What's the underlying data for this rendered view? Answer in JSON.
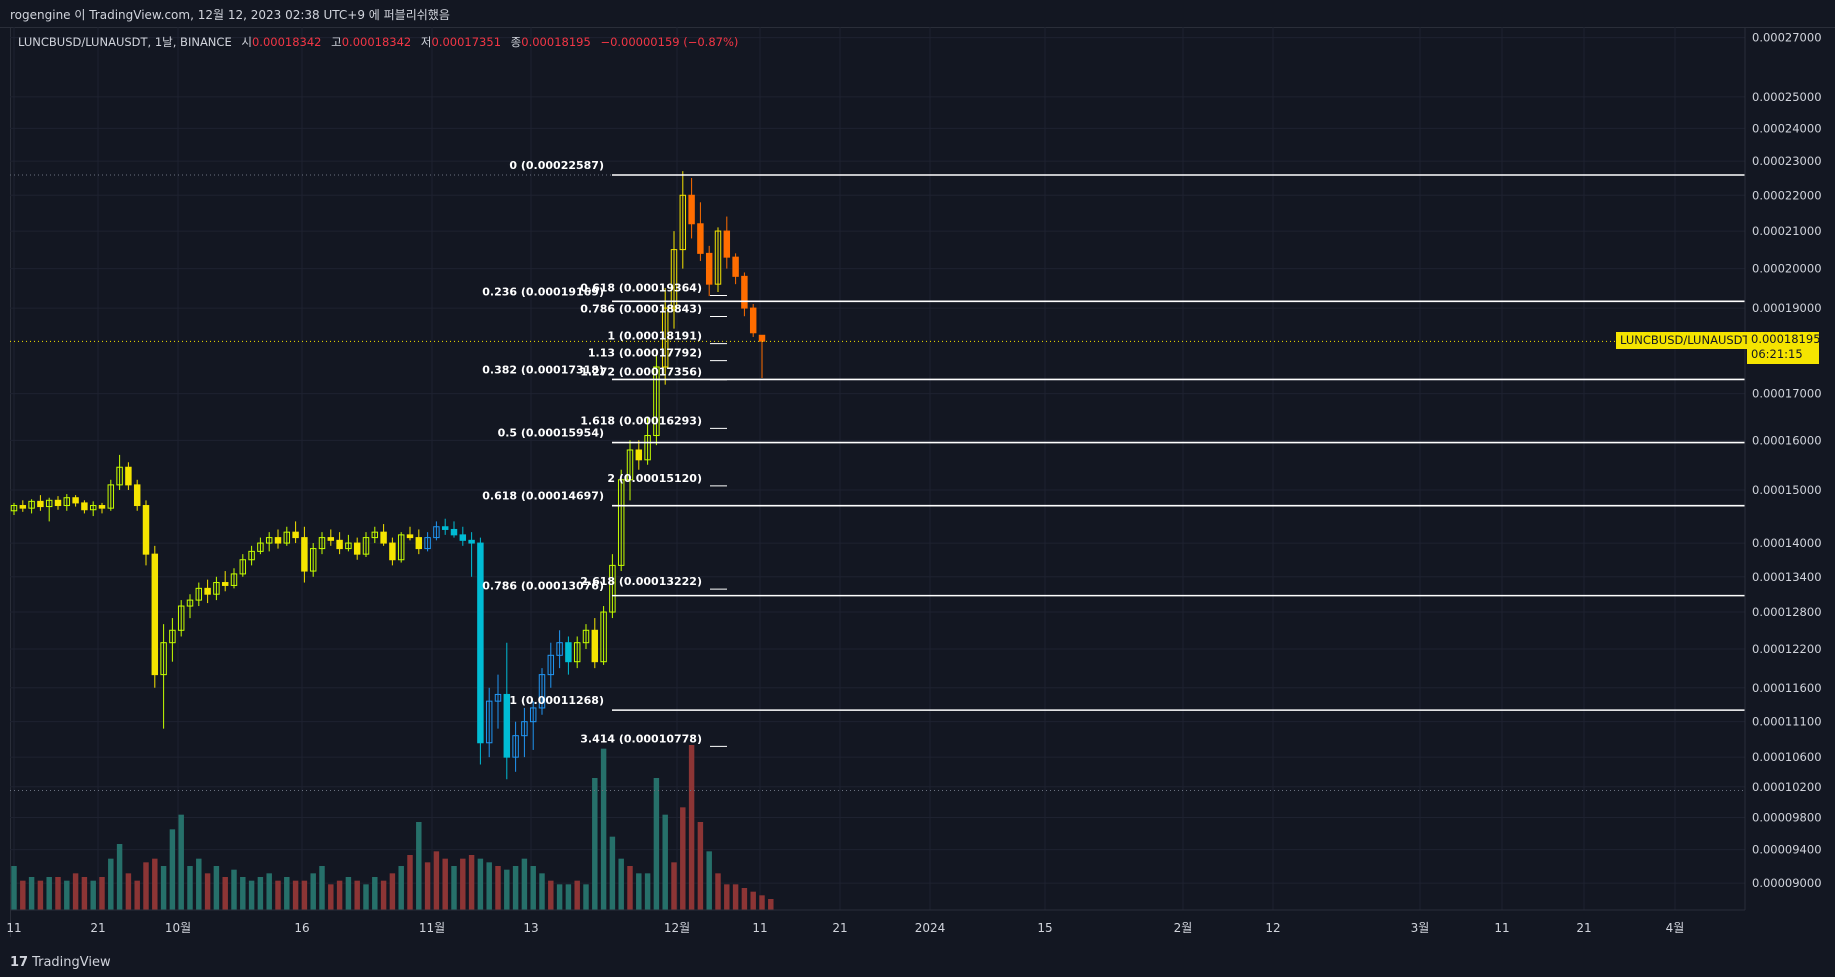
{
  "header": {
    "published": "rogengine 이 TradingView.com, 12월 12, 2023 02:38 UTC+9 에 퍼블리쉬했음"
  },
  "legend": {
    "symbol": "LUNCBUSD/LUNAUSDT, 1날, BINANCE",
    "open_label": "시",
    "open": "0.00018342",
    "high_label": "고",
    "high": "0.00018342",
    "low_label": "저",
    "low": "0.00017351",
    "close_label": "종",
    "close": "0.00018195",
    "change": "−0.00000159 (−0.87%)"
  },
  "price_tag": {
    "symbol": "LUNCBUSD/LUNAUSDT",
    "price": "0.00018195",
    "countdown": "06:21:15"
  },
  "footer": {
    "brand": "TradingView",
    "logo": "17"
  },
  "colors": {
    "background": "#131722",
    "grid": "#1f2330",
    "axis_text": "#d1d4dc",
    "price_tag": "#f5e400",
    "change": "#f23645"
  },
  "chart_data": {
    "type": "candlestick",
    "y_scale": "log",
    "ylim": [
      8.85e-05,
      0.000272
    ],
    "y_ticks": [
      "0.00027000",
      "0.00025000",
      "0.00024000",
      "0.00023000",
      "0.00022000",
      "0.00021000",
      "0.00020000",
      "0.00019000",
      "0.00017000",
      "0.00016000",
      "0.00015000",
      "0.00014000",
      "0.00013400",
      "0.00012800",
      "0.00012200",
      "0.00011600",
      "0.00011100",
      "0.00010600",
      "0.00010200",
      "0.00009800",
      "0.00009400",
      "0.00009000"
    ],
    "x_ticks": [
      "11",
      "21",
      "10월",
      "16",
      "11월",
      "13",
      "12월",
      "11",
      "21",
      "2024",
      "15",
      "2월",
      "12",
      "3월",
      "11",
      "21",
      "4월"
    ],
    "fib_retracement": [
      {
        "label": "0 (0.00022587)",
        "value": 0.00022587
      },
      {
        "label": "0.236 (0.00019169)",
        "value": 0.00019169
      },
      {
        "label": "0.382 (0.00017318)",
        "value": 0.00017318
      },
      {
        "label": "0.5 (0.00015954)",
        "value": 0.00015954
      },
      {
        "label": "0.618 (0.00014697)",
        "value": 0.00014697
      },
      {
        "label": "0.786 (0.00013076)",
        "value": 0.00013076
      },
      {
        "label": "1 (0.00011268)",
        "value": 0.00011268
      }
    ],
    "fib_extension": [
      {
        "label": "0.618 (0.00019364)",
        "value": 0.00019364
      },
      {
        "label": "0.786 (0.00018843)",
        "value": 0.00018843
      },
      {
        "label": "1 (0.00018191)",
        "value": 0.00018191
      },
      {
        "label": "1.13 (0.00017792)",
        "value": 0.00017792
      },
      {
        "label": "1.272 (0.00017356)",
        "value": 0.00017356
      },
      {
        "label": "1.618 (0.00016293)",
        "value": 0.00016293
      },
      {
        "label": "2 (0.00015120)",
        "value": 0.0001512
      },
      {
        "label": "2.618 (0.00013222)",
        "value": 0.00013222
      },
      {
        "label": "3.414 (0.00010778)",
        "value": 0.00010778
      }
    ],
    "candles": [
      [
        0.000146,
        0.0001475,
        0.0001452,
        0.000147
      ],
      [
        0.000147,
        0.000148,
        0.0001458,
        0.0001465
      ],
      [
        0.0001465,
        0.0001482,
        0.0001455,
        0.0001478
      ],
      [
        0.0001478,
        0.000149,
        0.000146,
        0.0001468
      ],
      [
        0.0001468,
        0.0001485,
        0.000144,
        0.000148
      ],
      [
        0.000148,
        0.0001488,
        0.0001462,
        0.000147
      ],
      [
        0.000147,
        0.0001492,
        0.000146,
        0.0001485
      ],
      [
        0.0001485,
        0.000149,
        0.0001468,
        0.0001475
      ],
      [
        0.0001475,
        0.000148,
        0.0001455,
        0.0001462
      ],
      [
        0.0001462,
        0.0001478,
        0.000145,
        0.000147
      ],
      [
        0.000147,
        0.0001475,
        0.0001455,
        0.0001465
      ],
      [
        0.0001465,
        0.000152,
        0.000146,
        0.000151
      ],
      [
        0.000151,
        0.000157,
        0.00015,
        0.0001545
      ],
      [
        0.0001545,
        0.0001555,
        0.00015,
        0.000151
      ],
      [
        0.000151,
        0.000152,
        0.000146,
        0.000147
      ],
      [
        0.000147,
        0.000148,
        0.000136,
        0.000138
      ],
      [
        0.000138,
        0.0001395,
        0.000116,
        0.000118
      ],
      [
        0.000118,
        0.000126,
        0.00011,
        0.000123
      ],
      [
        0.000123,
        0.000127,
        0.00012,
        0.000125
      ],
      [
        0.000125,
        0.00013,
        0.000124,
        0.000129
      ],
      [
        0.000129,
        0.000131,
        0.000127,
        0.00013
      ],
      [
        0.00013,
        0.000133,
        0.000129,
        0.000132
      ],
      [
        0.000132,
        0.0001335,
        0.0001295,
        0.000131
      ],
      [
        0.000131,
        0.000134,
        0.00013,
        0.000133
      ],
      [
        0.000133,
        0.000135,
        0.0001315,
        0.0001325
      ],
      [
        0.0001325,
        0.0001355,
        0.000132,
        0.0001345
      ],
      [
        0.0001345,
        0.000138,
        0.000134,
        0.000137
      ],
      [
        0.000137,
        0.0001395,
        0.000136,
        0.0001385
      ],
      [
        0.0001385,
        0.000141,
        0.000138,
        0.00014
      ],
      [
        0.00014,
        0.000142,
        0.0001385,
        0.000141
      ],
      [
        0.000141,
        0.0001425,
        0.000139,
        0.00014
      ],
      [
        0.00014,
        0.000143,
        0.0001395,
        0.000142
      ],
      [
        0.000142,
        0.000144,
        0.00014,
        0.000141
      ],
      [
        0.000141,
        0.000143,
        0.000133,
        0.000135
      ],
      [
        0.000135,
        0.00014,
        0.000134,
        0.000139
      ],
      [
        0.000139,
        0.000142,
        0.000138,
        0.000141
      ],
      [
        0.000141,
        0.0001425,
        0.0001395,
        0.0001405
      ],
      [
        0.0001405,
        0.000142,
        0.000138,
        0.000139
      ],
      [
        0.000139,
        0.0001415,
        0.0001385,
        0.00014
      ],
      [
        0.00014,
        0.000141,
        0.000137,
        0.000138
      ],
      [
        0.000138,
        0.000142,
        0.0001375,
        0.000141
      ],
      [
        0.000141,
        0.000143,
        0.00014,
        0.000142
      ],
      [
        0.000142,
        0.0001435,
        0.0001395,
        0.00014
      ],
      [
        0.00014,
        0.000141,
        0.000136,
        0.000137
      ],
      [
        0.000137,
        0.000142,
        0.0001365,
        0.0001415
      ],
      [
        0.0001415,
        0.000143,
        0.0001405,
        0.000141
      ],
      [
        0.000141,
        0.0001425,
        0.000138,
        0.000139
      ],
      [
        0.000139,
        0.000142,
        0.0001385,
        0.000141
      ],
      [
        0.000141,
        0.000144,
        0.0001405,
        0.000143
      ],
      [
        0.000143,
        0.0001445,
        0.0001415,
        0.0001425
      ],
      [
        0.0001425,
        0.000144,
        0.000141,
        0.0001415
      ],
      [
        0.0001415,
        0.000143,
        0.0001395,
        0.0001405
      ],
      [
        0.0001405,
        0.000142,
        0.000134,
        0.00014
      ],
      [
        0.00014,
        0.000141,
        0.000105,
        0.000108
      ],
      [
        0.000108,
        0.000116,
        0.000106,
        0.000114
      ],
      [
        0.000114,
        0.000118,
        0.00011,
        0.000115
      ],
      [
        0.000115,
        0.000123,
        0.000103,
        0.000106
      ],
      [
        0.000106,
        0.000111,
        0.000104,
        0.000109
      ],
      [
        0.000109,
        0.000113,
        0.000106,
        0.000111
      ],
      [
        0.000111,
        0.000114,
        0.000107,
        0.000113
      ],
      [
        0.000113,
        0.000119,
        0.000112,
        0.000118
      ],
      [
        0.000118,
        0.000123,
        0.000116,
        0.000121
      ],
      [
        0.000121,
        0.000125,
        0.000119,
        0.000123
      ],
      [
        0.000123,
        0.000124,
        0.000118,
        0.00012
      ],
      [
        0.00012,
        0.000124,
        0.000119,
        0.000123
      ],
      [
        0.000123,
        0.000126,
        0.000122,
        0.000125
      ],
      [
        0.000125,
        0.000127,
        0.000119,
        0.00012
      ],
      [
        0.00012,
        0.000129,
        0.0001195,
        0.000128
      ],
      [
        0.000128,
        0.000138,
        0.000127,
        0.000136
      ],
      [
        0.000136,
        0.000154,
        0.000135,
        0.000152
      ],
      [
        0.000152,
        0.00016,
        0.000148,
        0.000158
      ],
      [
        0.000158,
        0.00016,
        0.000154,
        0.000156
      ],
      [
        0.000156,
        0.000165,
        0.000155,
        0.000161
      ],
      [
        0.000161,
        0.00018,
        0.000159,
        0.000176
      ],
      [
        0.000176,
        0.000195,
        0.000172,
        0.00019
      ],
      [
        0.00019,
        0.00021,
        0.000185,
        0.000205
      ],
      [
        0.000205,
        0.000227,
        0.0002,
        0.00022
      ],
      [
        0.00022,
        0.000225,
        0.000208,
        0.000212
      ],
      [
        0.000212,
        0.000218,
        0.000202,
        0.000204
      ],
      [
        0.000204,
        0.000206,
        0.000193,
        0.000196
      ],
      [
        0.000196,
        0.000211,
        0.000194,
        0.00021
      ],
      [
        0.00021,
        0.000214,
        0.0002,
        0.000203
      ],
      [
        0.000203,
        0.000204,
        0.000196,
        0.000198
      ],
      [
        0.000198,
        0.000199,
        0.000188,
        0.00019
      ],
      [
        0.00019,
        0.000191,
        0.000183,
        0.000184
      ],
      [
        0.0001834,
        0.0001834,
        0.0001735,
        0.000182
      ]
    ],
    "volume": [
      12,
      8,
      9,
      8,
      9,
      9,
      8,
      10,
      9,
      8,
      9,
      14,
      18,
      10,
      8,
      13,
      14,
      12,
      22,
      26,
      12,
      14,
      10,
      12,
      9,
      11,
      9,
      8,
      9,
      10,
      8,
      9,
      8,
      8,
      10,
      12,
      7,
      8,
      9,
      8,
      7,
      9,
      8,
      10,
      12,
      15,
      24,
      13,
      16,
      14,
      12,
      14,
      15,
      14,
      13,
      12,
      11,
      12,
      14,
      12,
      10,
      8,
      7,
      7,
      8,
      7,
      36,
      44,
      20,
      14,
      12,
      10,
      10,
      36,
      26,
      13,
      28,
      45,
      24,
      16,
      10,
      7,
      7,
      6,
      5,
      4,
      3
    ],
    "volume_up": [
      1,
      0,
      1,
      0,
      1,
      0,
      1,
      0,
      0,
      1,
      0,
      1,
      1,
      0,
      0,
      0,
      0,
      1,
      1,
      1,
      1,
      1,
      0,
      1,
      0,
      1,
      1,
      1,
      1,
      1,
      0,
      1,
      0,
      0,
      1,
      1,
      0,
      0,
      1,
      0,
      1,
      1,
      0,
      0,
      1,
      0,
      1,
      0,
      0,
      0,
      1,
      0,
      0,
      1,
      1,
      0,
      1,
      1,
      1,
      1,
      1,
      0,
      1,
      1,
      0,
      1,
      1,
      1,
      1,
      1,
      0,
      1,
      1,
      1,
      1,
      0,
      0,
      0,
      0,
      1,
      0,
      0,
      0,
      0,
      0,
      0,
      0
    ]
  }
}
